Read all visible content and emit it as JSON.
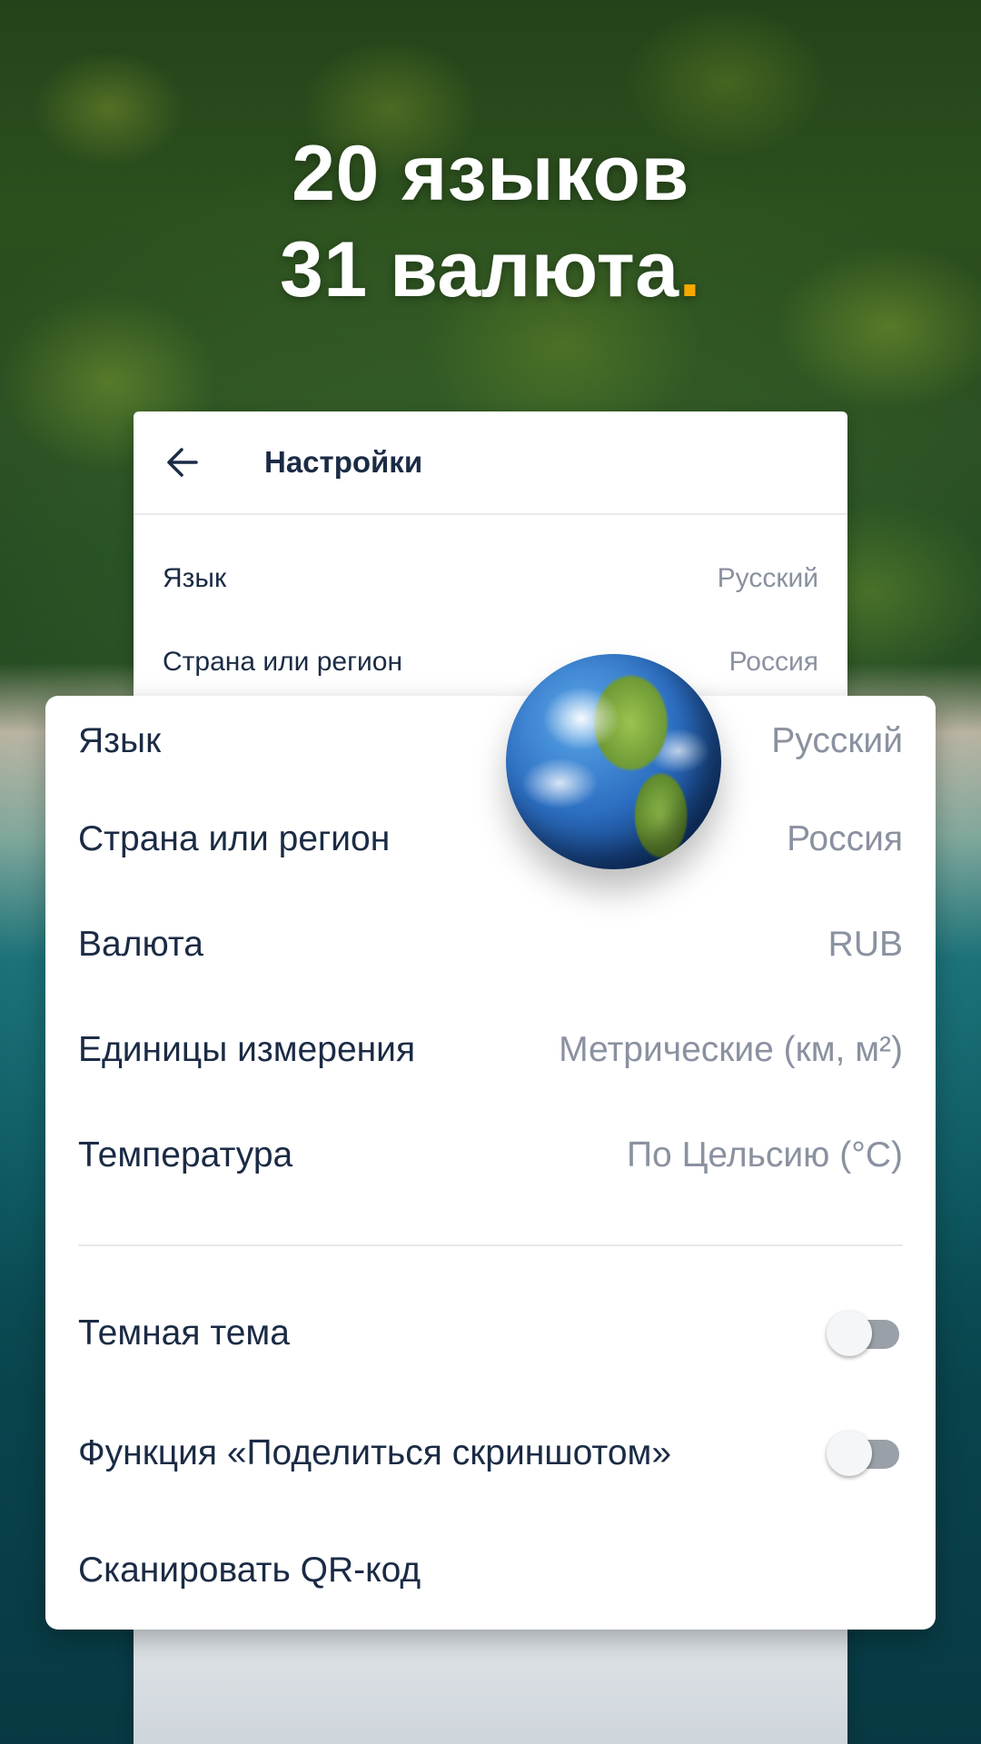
{
  "promo": {
    "line1": "20 языков",
    "line2_text": "31 валюта",
    "line2_dot": "."
  },
  "phone_screen": {
    "title": "Настройки",
    "rows": [
      {
        "label": "Язык",
        "value": "Русский"
      },
      {
        "label": "Страна или регион",
        "value": "Россия"
      }
    ]
  },
  "settings": {
    "rows": [
      {
        "label": "Язык",
        "value": "Русский"
      },
      {
        "label": "Страна или регион",
        "value": "Россия"
      },
      {
        "label": "Валюта",
        "value": "RUB"
      },
      {
        "label": "Единицы измерения",
        "value": "Метрические (км, м²)"
      },
      {
        "label": "Температура",
        "value": "По Цельсию (°C)"
      }
    ],
    "toggles": [
      {
        "label": "Темная тема",
        "on": false
      },
      {
        "label": "Функция «Поделиться скриншотом»",
        "on": false
      }
    ],
    "scan_label": "Сканировать QR-код"
  },
  "colors": {
    "accent_dot": "#f7a800",
    "text_primary": "#1b2b45",
    "text_secondary": "#8a91a0"
  },
  "icons": {
    "back": "arrow-left-icon",
    "globe": "globe-icon"
  }
}
